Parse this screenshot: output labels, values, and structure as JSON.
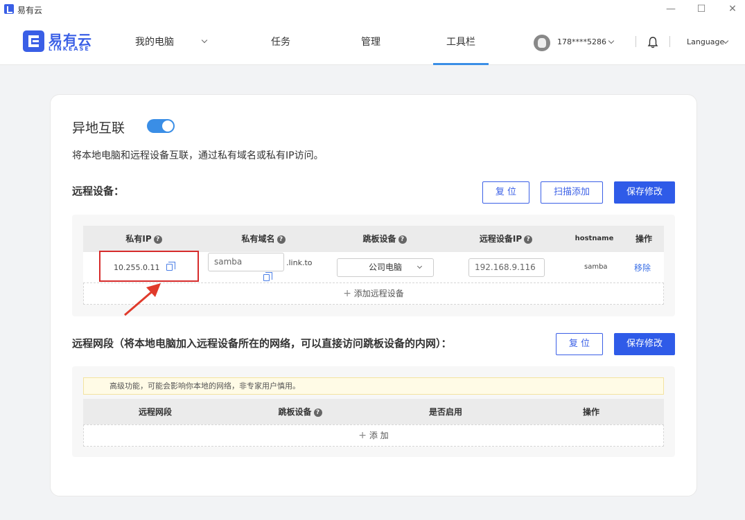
{
  "window": {
    "title": "易有云",
    "minimize": "—",
    "maximize": "☐",
    "close": "✕"
  },
  "brand": {
    "name": "易有云",
    "sub": "LINKEASE"
  },
  "nav": {
    "my_pc": "我的电脑",
    "tasks": "任务",
    "manage": "管理",
    "toolbar": "工具栏"
  },
  "user": {
    "phone": "178****5286"
  },
  "language": "Language",
  "section": {
    "title": "异地互联",
    "toggle_on": true,
    "description": "将本地电脑和远程设备互联，通过私有域名或私有IP访问。"
  },
  "remote_devices": {
    "title": "远程设备：",
    "buttons": {
      "reset": "复 位",
      "scan_add": "扫描添加",
      "save": "保存修改"
    },
    "columns": [
      "私有IP",
      "私有域名",
      "跳板设备",
      "远程设备IP",
      "hostname",
      "操作"
    ],
    "row": {
      "private_ip": "10.255.0.11",
      "domain_value": "samba",
      "domain_suffix": ".link.to",
      "jump_device": "公司电脑",
      "remote_ip": "192.168.9.116",
      "hostname": "samba",
      "action": "移除"
    },
    "add_label": "添加远程设备"
  },
  "remote_subnets": {
    "title": "远程网段（将本地电脑加入远程设备所在的网络，可以直接访问跳板设备的内网）：",
    "buttons": {
      "reset": "复 位",
      "save": "保存修改"
    },
    "warning": "高级功能，可能会影响你本地的网络，非专家用户慎用。",
    "columns": [
      "远程网段",
      "跳板设备",
      "是否启用",
      "操作"
    ],
    "add_label": "添 加"
  },
  "colors": {
    "accent": "#2f5be8",
    "highlight": "#d62b2b"
  }
}
